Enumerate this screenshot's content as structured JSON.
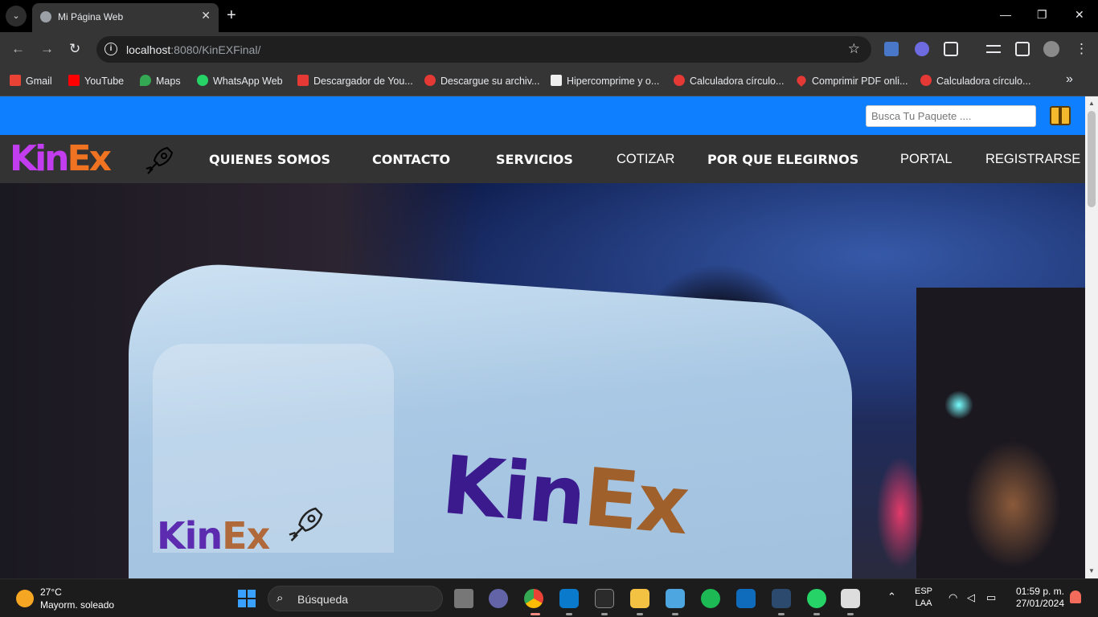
{
  "browser": {
    "tab_title": "Mi Página Web",
    "url_host": "localhost",
    "url_rest": ":8080/KinEXFinal/",
    "bookmarks": [
      {
        "label": "Gmail",
        "color": "#ea4335"
      },
      {
        "label": "YouTube",
        "color": "#ff0000"
      },
      {
        "label": "Maps",
        "color": "#34a853"
      },
      {
        "label": "WhatsApp Web",
        "color": "#25d366"
      },
      {
        "label": "Descargador de You...",
        "color": "#e53935"
      },
      {
        "label": "Descargue su archiv...",
        "color": "#e53935"
      },
      {
        "label": "Hipercomprime y o...",
        "color": "#eeeeee"
      },
      {
        "label": "Calculadora círculo...",
        "color": "#e53935"
      },
      {
        "label": "Comprimir PDF onli...",
        "color": "#e53935"
      },
      {
        "label": "Calculadora círculo...",
        "color": "#e53935"
      }
    ]
  },
  "site": {
    "search_placeholder": "Busca Tu Paquete ....",
    "logo_k": "Kin",
    "logo_e": "Ex",
    "nav": [
      {
        "label": "QUIENES SOMOS"
      },
      {
        "label": "CONTACTO"
      },
      {
        "label": "SERVICIOS"
      },
      {
        "label": "COTIZAR"
      },
      {
        "label": "POR QUE ELEGIRNOS"
      },
      {
        "label": "PORTAL"
      },
      {
        "label": "REGISTRARSE"
      }
    ],
    "hero_brand_k": "Kin",
    "hero_brand_e": "Ex",
    "accent": "#0e80ff",
    "navbar_bg": "#333333"
  },
  "taskbar": {
    "temp": "27°C",
    "weather": "Mayorm. soleado",
    "search_label": "Búsqueda",
    "lang_top": "ESP",
    "lang_bottom": "LAA",
    "time": "01:59 p. m.",
    "date": "27/01/2024"
  }
}
